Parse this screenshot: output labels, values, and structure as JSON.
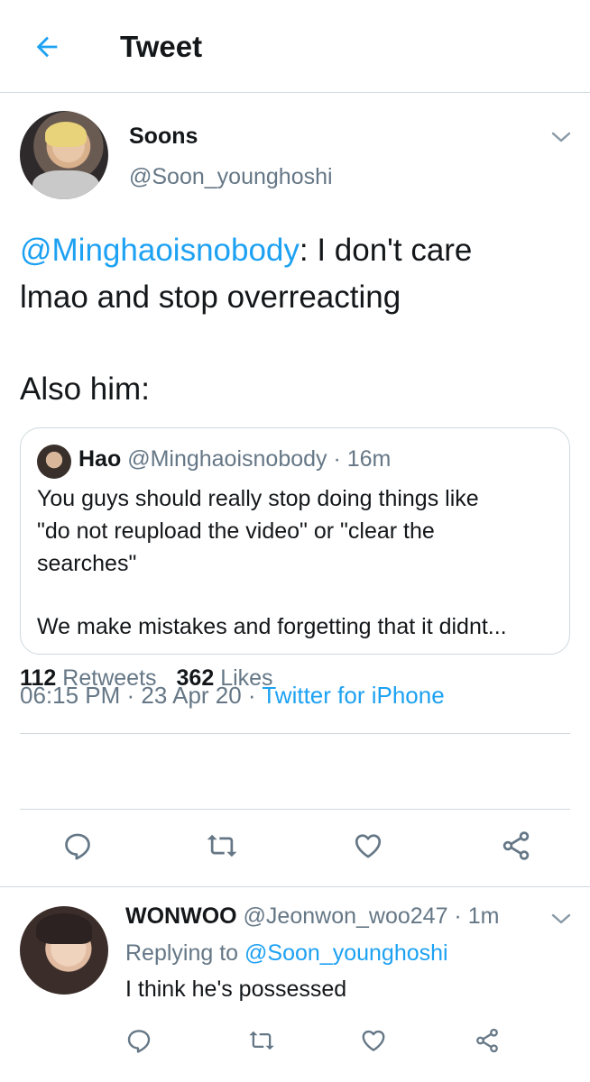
{
  "header": {
    "title": "Tweet"
  },
  "tweet": {
    "display_name": "Soons",
    "handle": "@Soon_younghoshi",
    "mention": "@Minghaoisnobody",
    "text_after_mention": ": I don't care",
    "text_line2": "lmao and stop overreacting",
    "text_line3": "Also him:",
    "quote": {
      "name": "Hao",
      "meta": "@Minghaoisnobody · 16m",
      "body_line1": "You guys should really stop doing things like",
      "body_line2": "\"do not reupload the video\" or \"clear the",
      "body_line3": "searches\"",
      "body_line4": "We make mistakes and forgetting that it didnt..."
    },
    "timestamp": "06:15 PM · 23 Apr 20 · ",
    "source": "Twitter for iPhone",
    "retweets_count": "112",
    "retweets_label": "Retweets",
    "likes_count": "362",
    "likes_label": "Likes"
  },
  "icons": {
    "back": "arrow-left-icon",
    "chevron": "chevron-down-icon",
    "reply": "reply-icon",
    "retweet": "retweet-icon",
    "like": "heart-icon",
    "share": "share-icon"
  },
  "colors": {
    "accent": "#1da1f2",
    "muted": "#657786",
    "text": "#14171a",
    "border": "#cfd9de"
  },
  "reply": {
    "name": "WONWOO",
    "meta": "@Jeonwon_woo247 · 1m",
    "replying_prefix": "Replying to ",
    "replying_handle": "@Soon_younghoshi",
    "text": "I think he's possessed"
  }
}
